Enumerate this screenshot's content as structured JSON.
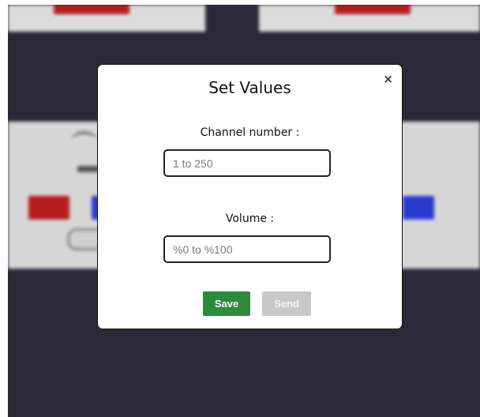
{
  "modal": {
    "title": "Set Values",
    "close_symbol": "×",
    "channel": {
      "label": "Channel number :",
      "placeholder": "1 to 250",
      "value": ""
    },
    "volume": {
      "label": "Volume :",
      "placeholder": "%0 to %100",
      "value": ""
    },
    "save_label": "Save",
    "send_label": "Send"
  },
  "colors": {
    "save_button": "#2e8b3c",
    "send_button_disabled": "#c8c8c8",
    "overlay_background": "#2b2937"
  },
  "icons": {
    "close": "close-icon"
  }
}
